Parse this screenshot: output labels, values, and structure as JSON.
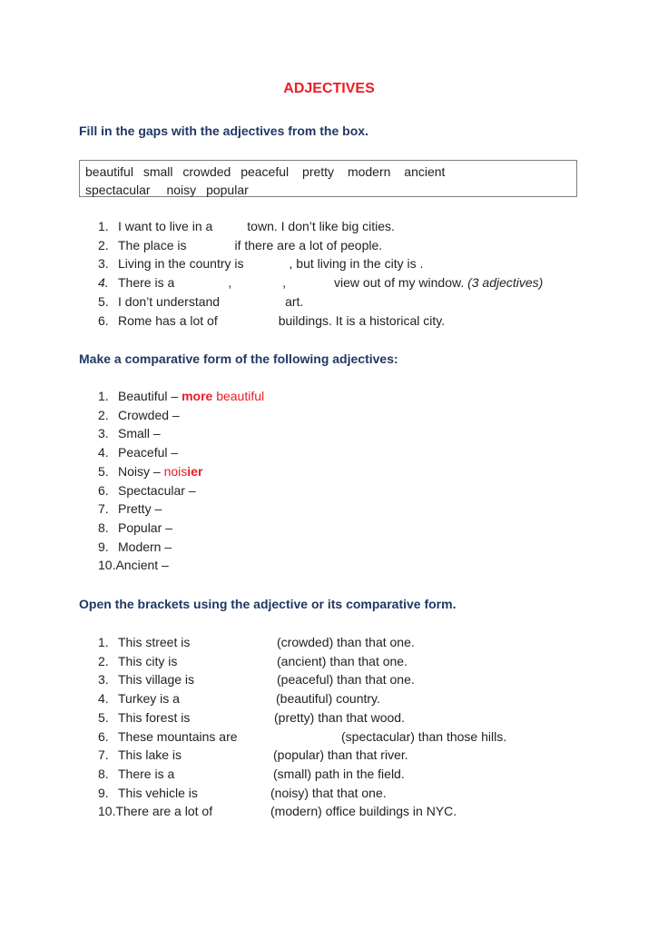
{
  "title": "ADJECTIVES",
  "section1": {
    "heading": "Fill in the gaps with the adjectives from the box.",
    "word_box": [
      "beautiful",
      "small",
      "crowded",
      "peaceful",
      "pretty",
      "modern",
      "ancient",
      "spectacular",
      "noisy",
      "popular"
    ],
    "items": [
      {
        "num": "1.",
        "before": "I want to live in a",
        "after": "town. I don’t like big cities."
      },
      {
        "num": "2.",
        "before": "The place is",
        "after": "if there are a lot of people."
      },
      {
        "num": "3.",
        "before": "Living in the country is",
        "after": ", but living in the city is ."
      },
      {
        "num": "4.",
        "before": "There is a",
        "sep1": ",",
        "sep2": ",",
        "after": "view out of my window.",
        "note": "(3 adjectives)"
      },
      {
        "num": "5.",
        "before": "I don’t understand",
        "after": "art."
      },
      {
        "num": "6.",
        "before": "Rome has a lot of",
        "after": "buildings. It is a historical city."
      }
    ]
  },
  "section2": {
    "heading": "Make a comparative form of the following adjectives:",
    "items": [
      {
        "num": "1.",
        "word": "Beautiful –",
        "answer_bold": "more",
        "answer": "beautiful"
      },
      {
        "num": "2.",
        "word": "Crowded –"
      },
      {
        "num": "3.",
        "word": "Small –"
      },
      {
        "num": "4.",
        "word": "Peaceful –"
      },
      {
        "num": "5.",
        "word": "Noisy –",
        "answer": "nois",
        "answer_bold": "ier"
      },
      {
        "num": "6.",
        "word": "Spectacular –"
      },
      {
        "num": "7.",
        "word": "Pretty –"
      },
      {
        "num": "8.",
        "word": "Popular –"
      },
      {
        "num": "9.",
        "word": "Modern –"
      },
      {
        "num": "10.",
        "word": "Ancient –"
      }
    ]
  },
  "section3": {
    "heading": "Open the brackets using the adjective or its comparative form.",
    "items": [
      {
        "num": "1.",
        "before": "This street is",
        "after": "(crowded) than that one."
      },
      {
        "num": "2.",
        "before": "This city is",
        "after": "(ancient) than that one."
      },
      {
        "num": "3.",
        "before": "This village is",
        "after": "(peaceful) than that one."
      },
      {
        "num": "4.",
        "before": "Turkey is a",
        "after": "(beautiful) country."
      },
      {
        "num": "5.",
        "before": "This forest is",
        "after": "(pretty) than that wood."
      },
      {
        "num": "6.",
        "before": "These mountains are",
        "after": "(spectacular) than those hills."
      },
      {
        "num": "7.",
        "before": "This lake is",
        "after": "(popular) than that river."
      },
      {
        "num": "8.",
        "before": "There is a",
        "after": "(small) path in the field."
      },
      {
        "num": "9.",
        "before": "This vehicle is",
        "after": "(noisy) that that one."
      },
      {
        "num": "10.",
        "before": "There are a lot of",
        "after": "(modern) office buildings in NYC."
      }
    ]
  }
}
